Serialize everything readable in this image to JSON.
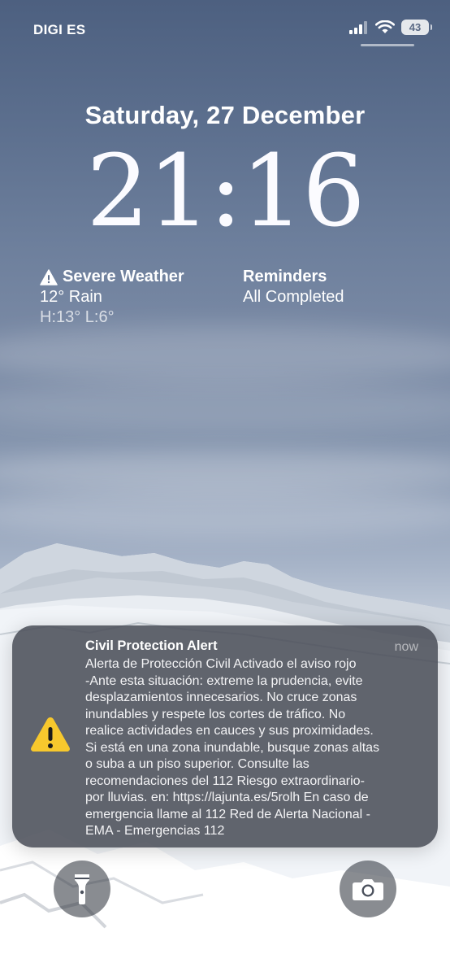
{
  "status_bar": {
    "carrier": "DIGI ES",
    "battery": "43",
    "icons": [
      "signal-icon",
      "wifi-icon",
      "battery-icon"
    ]
  },
  "lock_screen": {
    "date": "Saturday, 27 December",
    "time": "21:16"
  },
  "widgets": {
    "weather": {
      "icon": "warning-icon",
      "title": "Severe Weather",
      "line1": "12° Rain",
      "line2": "H:13° L:6°"
    },
    "reminders": {
      "title": "Reminders",
      "line1": "All Completed"
    }
  },
  "notification": {
    "icon": "warning-triangle-icon",
    "title": "Civil Protection Alert",
    "time": "now",
    "body": "Alerta de Protección Civil Activado el aviso rojo\n-Ante esta situación: extreme la prudencia, evite\ndesplazamientos innecesarios. No cruce zonas\ninundables y respete los cortes de tráfico. No\nrealice actividades en cauces y sus proximidades.\nSi está en una zona inundable, busque zonas altas\no suba a un piso superior. Consulte las\nrecomendaciones del 112 Riesgo extraordinario-\npor lluvias.  en: https://lajunta.es/5rolh En caso de\nemergencia llame al 112 Red de Alerta Nacional -\nEMA - Emergencias 112",
    "accent_color": "#f7c82d"
  },
  "quick_actions": {
    "left": "flashlight-icon",
    "right": "camera-icon"
  }
}
